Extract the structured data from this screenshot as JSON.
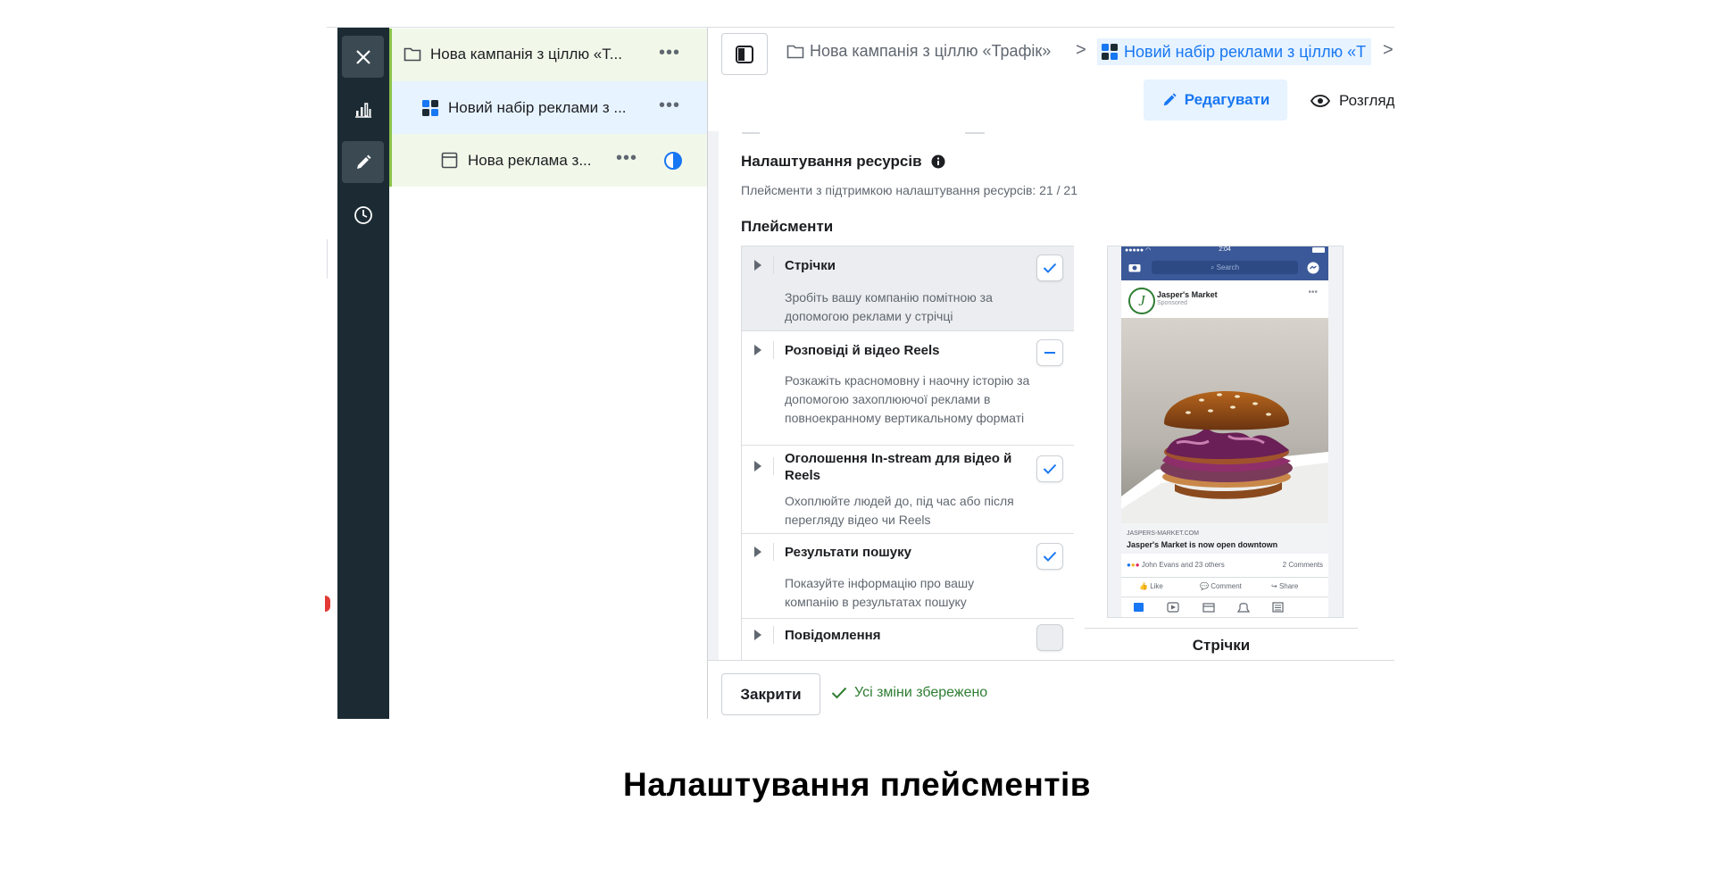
{
  "tree": {
    "campaign": "Нова кампанія з ціллю «Т...",
    "adset": "Новий набір реклами з ...",
    "ad": "Нова реклама з...",
    "more": "•••"
  },
  "breadcrumb": {
    "campaign": "Нова кампанія з ціллю «Трафік»",
    "separator": ">",
    "adset": "Новий набір реклами з ціллю «Т"
  },
  "actions": {
    "edit_label": "Редагувати",
    "view_label": "Розгляд"
  },
  "resources": {
    "title": "Налаштування ресурсів",
    "subtitle": "Плейсменти з підтримкою налаштування ресурсів: 21 / 21"
  },
  "placements": {
    "title": "Плейсменти",
    "items": [
      {
        "title": "Стрічки",
        "desc": "Зробіть вашу компанію помітною за допомогою реклами у стрічці",
        "state": "checked"
      },
      {
        "title": "Розповіді й відео Reels",
        "desc": "Розкажіть красномовну і наочну історію за допомогою захоплюючої реклами в повноекранному вертикальному форматі",
        "state": "partial"
      },
      {
        "title": "Оголошення In-stream для відео й Reels",
        "desc": "Охоплюйте людей до, під час або після перегляду відео чи Reels",
        "state": "checked"
      },
      {
        "title": "Результати пошуку",
        "desc": "Показуйте інформацію про вашу компанію в результатах пошуку",
        "state": "checked"
      },
      {
        "title": "Повідомлення",
        "desc": "",
        "state": "unchecked"
      }
    ]
  },
  "preview": {
    "time": "2:04",
    "search": "Search",
    "page_name": "Jasper's Market",
    "sponsored": "Sponsored",
    "link_domain": "JASPERS-MARKET.COM",
    "link_title": "Jasper's Market is now open downtown",
    "reactions": "John Evans and 23 others",
    "comments": "2 Comments",
    "like": "Like",
    "comment": "Comment",
    "share": "Share",
    "label": "Стрічки"
  },
  "footer": {
    "close_label": "Закрити",
    "saved_text": "Усі зміни збережено"
  },
  "caption": "Налаштування плейсментів",
  "colors": {
    "accent": "#1877f2",
    "rail": "#1c2b33",
    "saved": "#2e7d32",
    "tree_bar": "#8bc34a"
  }
}
